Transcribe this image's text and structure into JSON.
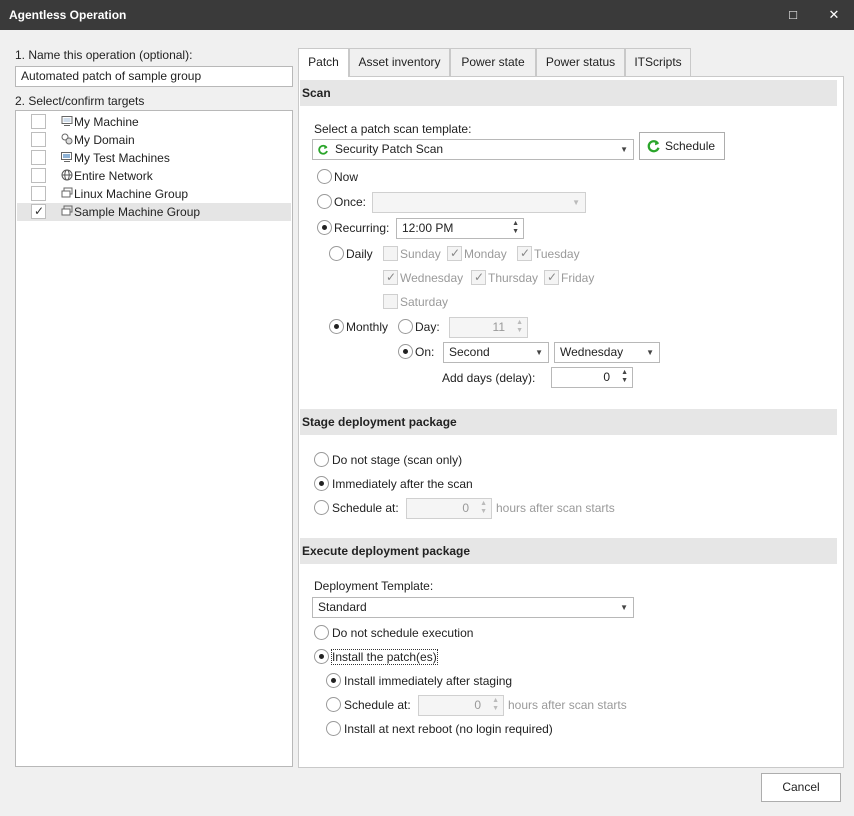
{
  "window": {
    "title": "Agentless Operation",
    "maximize_glyph": "□",
    "close_glyph": "✕"
  },
  "left": {
    "name_label": "1. Name this operation (optional):",
    "name_value": "Automated patch of sample group",
    "targets_label": "2. Select/confirm targets",
    "tree": [
      {
        "label": "My Machine",
        "icon": "computer-icon",
        "checked": false
      },
      {
        "label": "My Domain",
        "icon": "domain-icon",
        "checked": false
      },
      {
        "label": "My Test Machines",
        "icon": "machine-group-icon",
        "checked": false
      },
      {
        "label": "Entire Network",
        "icon": "globe-icon",
        "checked": false
      },
      {
        "label": "Linux Machine Group",
        "icon": "machine-group-icon",
        "checked": false
      },
      {
        "label": "Sample Machine Group",
        "icon": "machine-group-icon",
        "checked": true,
        "selected": true
      }
    ]
  },
  "tabs": [
    "Patch",
    "Asset inventory",
    "Power state",
    "Power status",
    "ITScripts"
  ],
  "active_tab": "Patch",
  "scan": {
    "header": "Scan",
    "template_label": "Select a patch scan template:",
    "template_value": "Security Patch Scan",
    "schedule_button": "Schedule",
    "now_label": "Now",
    "once_label": "Once:",
    "once_value": "",
    "recurring_label": "Recurring:",
    "recurring_time": "12:00 PM",
    "daily_label": "Daily",
    "days": [
      {
        "label": "Sunday",
        "checked": false
      },
      {
        "label": "Monday",
        "checked": true
      },
      {
        "label": "Tuesday",
        "checked": true
      },
      {
        "label": "Wednesday",
        "checked": true
      },
      {
        "label": "Thursday",
        "checked": true
      },
      {
        "label": "Friday",
        "checked": true
      },
      {
        "label": "Saturday",
        "checked": false
      }
    ],
    "monthly_label": "Monthly",
    "day_label": "Day:",
    "day_value": "11",
    "on_label": "On:",
    "on_ordinal": "Second",
    "on_weekday": "Wednesday",
    "add_days_label": "Add days (delay):",
    "add_days_value": "0"
  },
  "stage": {
    "header": "Stage deployment package",
    "do_not_stage": "Do not stage (scan only)",
    "immediately": "Immediately after the scan",
    "schedule_at": "Schedule at:",
    "schedule_value": "0",
    "hours_after": "hours after scan starts"
  },
  "execute": {
    "header": "Execute deployment package",
    "template_label": "Deployment Template:",
    "template_value": "Standard",
    "do_not_schedule": "Do not schedule execution",
    "install": "Install the patch(es)",
    "install_immediately": "Install immediately after staging",
    "schedule_at": "Schedule at:",
    "schedule_value": "0",
    "hours_after": "hours after scan starts",
    "next_reboot": "Install at next reboot (no login required)"
  },
  "footer": {
    "cancel": "Cancel"
  },
  "colors": {
    "titlebar": "#3a3a3a",
    "section_header": "#e6e6e6",
    "scan_icon": "#2aa52a",
    "selection": "#e5e5e5"
  }
}
